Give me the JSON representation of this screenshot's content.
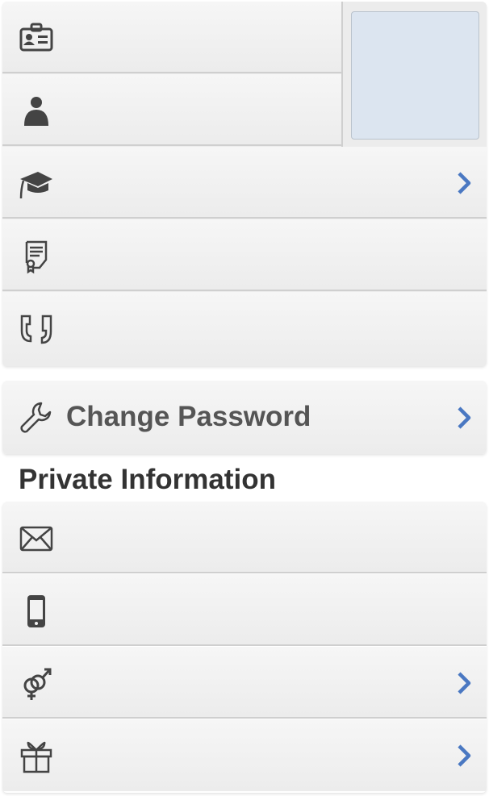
{
  "colors": {
    "chevron": "#4a78c2",
    "icon": "#444444",
    "photo": "#dce5f0"
  },
  "profile_group": {
    "rows": [
      {
        "icon": "id-card-icon",
        "has_chevron": false
      },
      {
        "icon": "person-icon",
        "has_chevron": false
      },
      {
        "icon": "graduation-cap-icon",
        "has_chevron": true
      },
      {
        "icon": "certificate-icon",
        "has_chevron": false
      },
      {
        "icon": "quote-icon",
        "has_chevron": false
      }
    ]
  },
  "password_group": {
    "label": "Change Password",
    "icon": "wrench-icon"
  },
  "private_section": {
    "title": "Private Information",
    "rows": [
      {
        "icon": "envelope-icon",
        "has_chevron": false
      },
      {
        "icon": "mobile-phone-icon",
        "has_chevron": false
      },
      {
        "icon": "gender-icon",
        "has_chevron": true
      },
      {
        "icon": "gift-icon",
        "has_chevron": true
      }
    ]
  }
}
